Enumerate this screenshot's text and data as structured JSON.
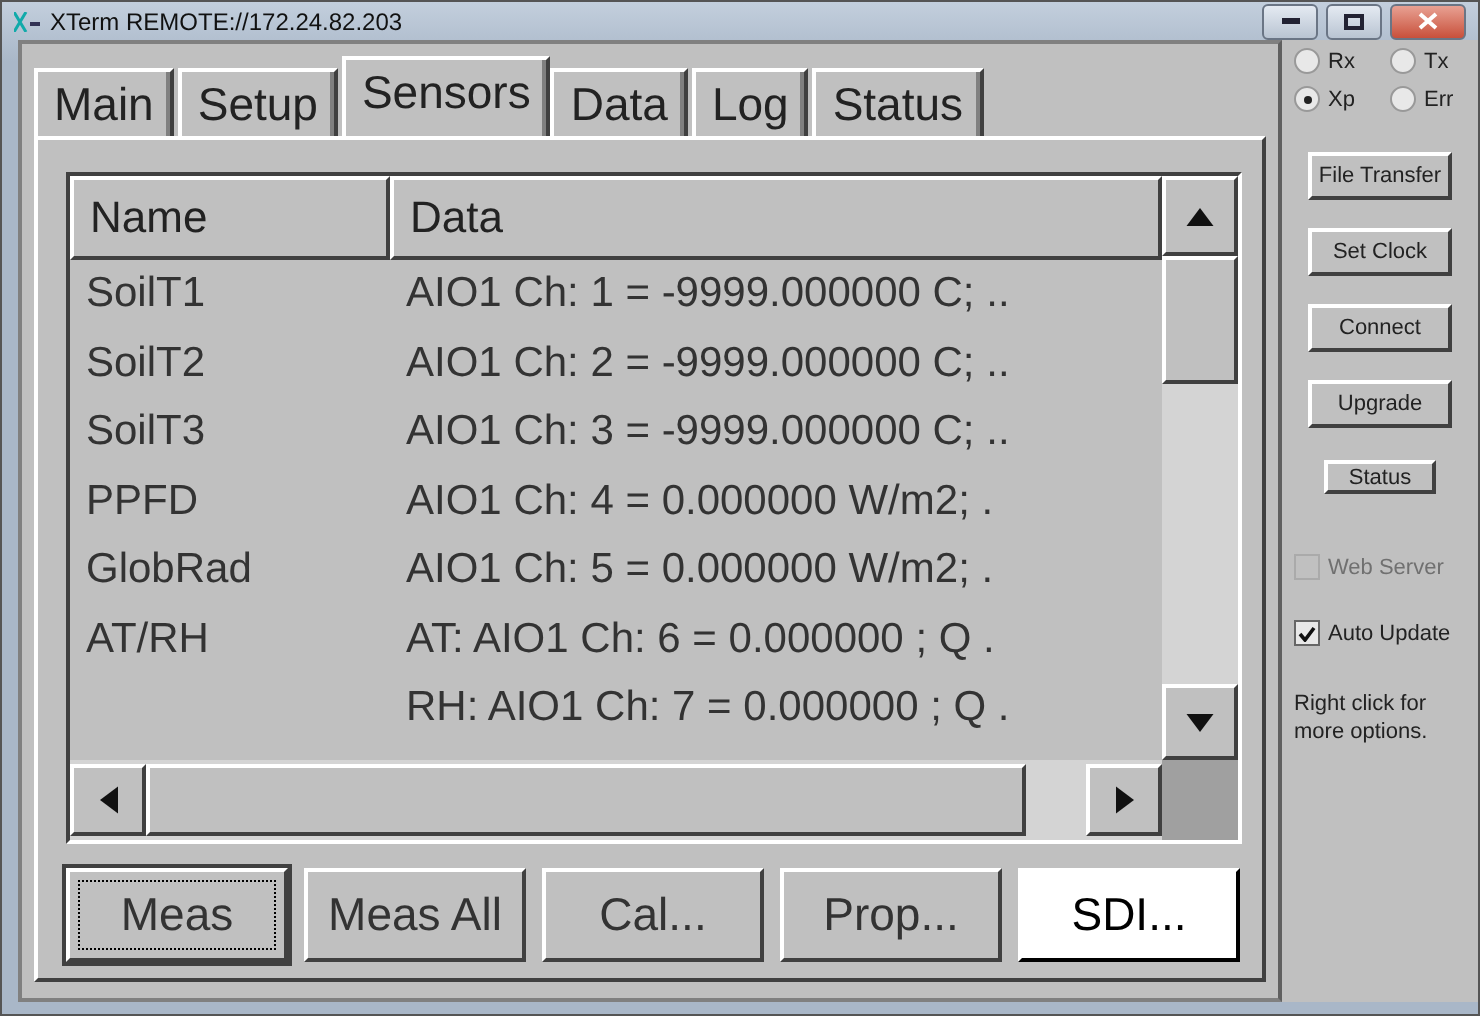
{
  "window": {
    "title": "XTerm REMOTE://172.24.82.203"
  },
  "tabs": [
    {
      "label": "Main",
      "selected": false
    },
    {
      "label": "Setup",
      "selected": false
    },
    {
      "label": "Sensors",
      "selected": true
    },
    {
      "label": "Data",
      "selected": false
    },
    {
      "label": "Log",
      "selected": false
    },
    {
      "label": "Status",
      "selected": false
    }
  ],
  "table": {
    "columns": [
      "Name",
      "Data"
    ],
    "rows": [
      {
        "name": "SoilT1",
        "data": "AIO1 Ch: 1 = -9999.000000 C; .."
      },
      {
        "name": "SoilT2",
        "data": "AIO1 Ch: 2 = -9999.000000 C; .."
      },
      {
        "name": "SoilT3",
        "data": "AIO1 Ch: 3 = -9999.000000 C; .."
      },
      {
        "name": "PPFD",
        "data": "AIO1 Ch: 4 = 0.000000 W/m2; ."
      },
      {
        "name": "GlobRad",
        "data": "AIO1 Ch: 5 = 0.000000 W/m2; ."
      },
      {
        "name": "AT/RH",
        "data": "AT: AIO1 Ch: 6 = 0.000000 ; Q ."
      },
      {
        "data": "RH: AIO1 Ch: 7 = 0.000000 ; Q ."
      }
    ]
  },
  "bottom_buttons": [
    {
      "label": "Meas",
      "focused": true,
      "highlighted": false
    },
    {
      "label": "Meas All",
      "focused": false,
      "highlighted": false
    },
    {
      "label": "Cal...",
      "focused": false,
      "highlighted": false
    },
    {
      "label": "Prop...",
      "focused": false,
      "highlighted": false
    },
    {
      "label": "SDI...",
      "focused": false,
      "highlighted": true
    }
  ],
  "indicators": [
    {
      "label": "Rx",
      "selected": false
    },
    {
      "label": "Tx",
      "selected": false
    },
    {
      "label": "Xp",
      "selected": true
    },
    {
      "label": "Err",
      "selected": false
    }
  ],
  "side_buttons": [
    {
      "label": "File Transfer",
      "kind": "wide"
    },
    {
      "label": "Set Clock",
      "kind": "wide"
    },
    {
      "label": "Connect",
      "kind": "wide"
    },
    {
      "label": "Upgrade",
      "kind": "wide"
    },
    {
      "label": "Status",
      "kind": "small"
    }
  ],
  "checkboxes": [
    {
      "label": "Web Server",
      "checked": false,
      "disabled": true
    },
    {
      "label": "Auto Update",
      "checked": true,
      "disabled": false
    }
  ],
  "hint": "Right click for more options."
}
